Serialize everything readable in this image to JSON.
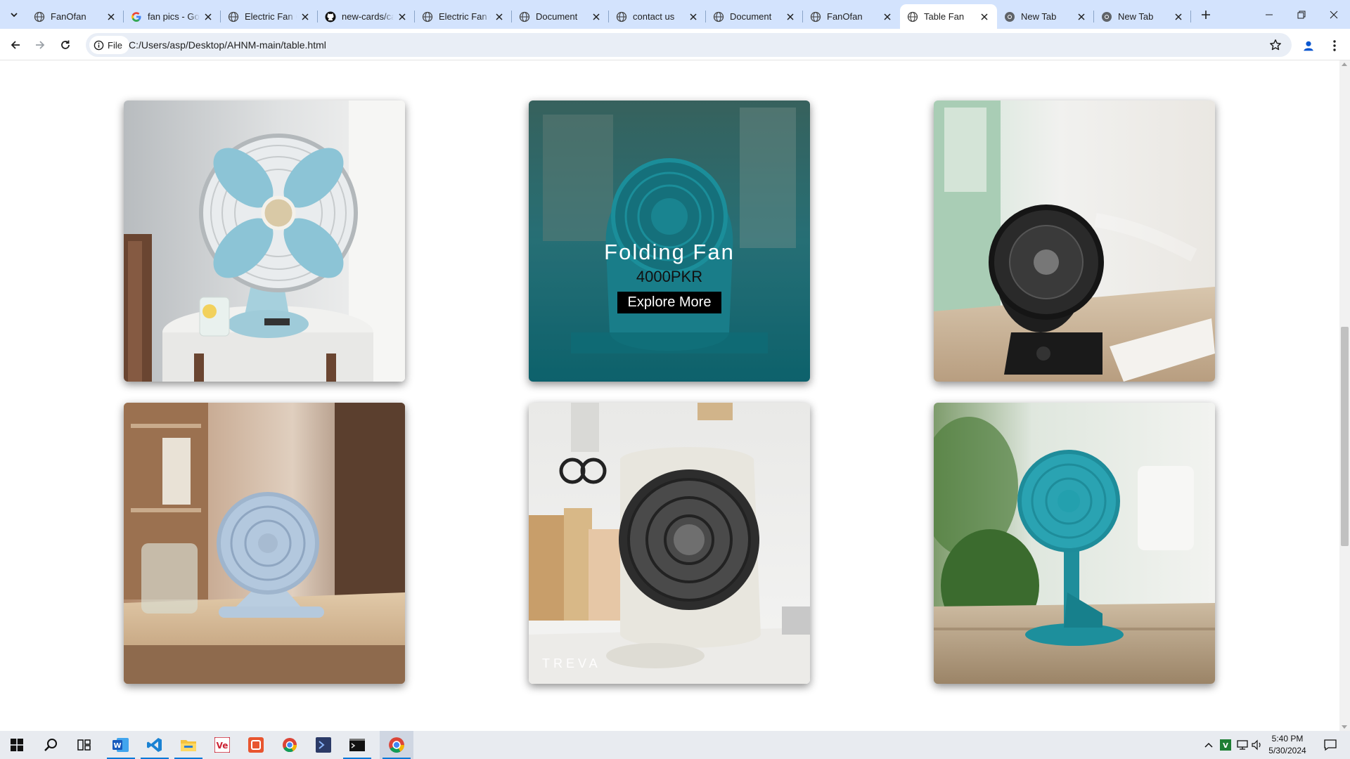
{
  "browser": {
    "tabs": [
      {
        "title": "FanOfan",
        "icon": "globe-icon"
      },
      {
        "title": "fan pics - Google Search",
        "icon": "google-icon"
      },
      {
        "title": "Electric Fan Cards",
        "icon": "globe-icon"
      },
      {
        "title": "new-cards/cards",
        "icon": "github-icon"
      },
      {
        "title": "Electric Fan Cards",
        "icon": "globe-icon"
      },
      {
        "title": "Document",
        "icon": "globe-icon"
      },
      {
        "title": "contact us",
        "icon": "globe-icon"
      },
      {
        "title": "Document",
        "icon": "globe-icon"
      },
      {
        "title": "FanOfan",
        "icon": "globe-icon"
      },
      {
        "title": "Table Fan",
        "icon": "globe-icon",
        "active": true
      },
      {
        "title": "New Tab",
        "icon": "chrome-icon"
      },
      {
        "title": "New Tab",
        "icon": "chrome-icon"
      }
    ],
    "address": {
      "scheme_label": "File",
      "url": "C:/Users/asp/Desktop/AHNM-main/table.html"
    }
  },
  "page": {
    "cards": [
      {
        "name": "card-retro-table-fan",
        "image": "retro-table-fan"
      },
      {
        "name": "card-folding-fan",
        "image": "folding-fan",
        "hover": true,
        "product_name": "Folding Fan",
        "price": "4000PKR",
        "button": "Explore More"
      },
      {
        "name": "card-black-desk-fan",
        "image": "black-desk-fan"
      },
      {
        "name": "card-blue-circulator-fan",
        "image": "blue-circulator-fan"
      },
      {
        "name": "card-treva-box-fan",
        "image": "treva-box-fan",
        "watermark": "TREVA"
      },
      {
        "name": "card-teal-pedestal-fan",
        "image": "teal-pedestal-fan"
      }
    ]
  },
  "taskbar": {
    "apps": [
      "start-icon",
      "search-icon",
      "task-view-icon",
      "word-icon",
      "vscode-icon",
      "file-explorer-icon",
      "ve-app-icon",
      "app-icon",
      "chrome-icon",
      "terminal-icon",
      "cmd-icon",
      "chrome-active-icon"
    ],
    "clock": {
      "time": "5:40 PM",
      "date": "5/30/2024"
    }
  },
  "colors": {
    "tabstrip": "#d3e3fd",
    "accent": "#0b57d0",
    "folding_fan_teal": "#1d8f9c"
  }
}
